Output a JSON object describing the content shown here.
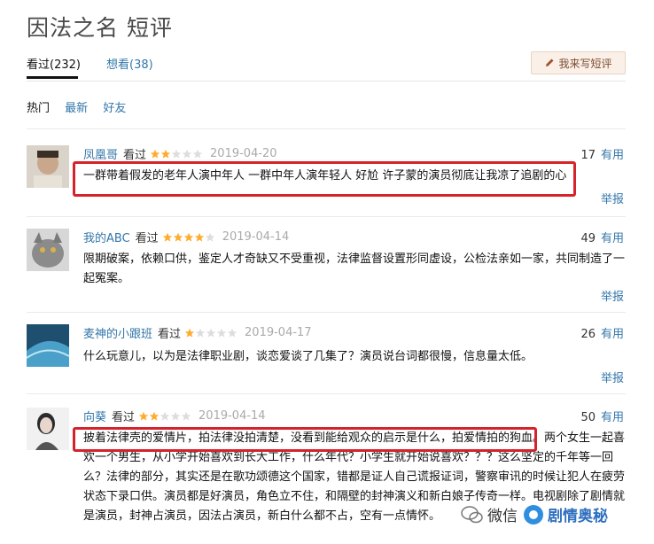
{
  "page": {
    "title": "因法之名 短评"
  },
  "tabs": [
    {
      "label": "看过(232)"
    },
    {
      "label": "想看(38)"
    }
  ],
  "write_button": {
    "label": "我来写短评"
  },
  "sort": [
    "热门",
    "最新",
    "好友"
  ],
  "watched_label": "看过",
  "useful_label": "有用",
  "report_label": "举报",
  "reviews": [
    {
      "user": "凤凰哥",
      "rating": 2,
      "date": "2019-04-20",
      "useful": "17",
      "text": "一群带着假发的老年人演中年人 一群中年人演年轻人 好尬 许子蒙的演员彻底让我凉了追剧的心",
      "avatar_color": "#c9a78c"
    },
    {
      "user": "我的ABC",
      "rating": 4,
      "date": "2019-04-14",
      "useful": "49",
      "text": "限期破案，依赖口供，鉴定人才奇缺又不受重视，法律监督设置形同虚设，公检法亲如一家，共同制造了一起冤案。",
      "avatar_color": "#8b8b8b"
    },
    {
      "user": "麦神的小跟班",
      "rating": 1,
      "date": "2019-04-17",
      "useful": "26",
      "text": "什么玩意儿，以为是法律职业剧，谈恋爱谈了几集了？演员说台词都很慢，信息量太低。",
      "avatar_color": "#4aa0c8"
    },
    {
      "user": "向葵",
      "rating": 2,
      "date": "2019-04-14",
      "useful": "50",
      "text": "披着法律壳的爱情片，拍法律没拍清楚，没看到能给观众的启示是什么，拍爱情拍的狗血。两个女生一起喜欢一个男生，从小学开始喜欢到长大工作，什么年代？小学生就开始说喜欢？？？这么坚定的千年等一回么？法律的部分，其实还是在歌功颂德这个国家，错都是证人自己谎报证词，警察审讯的时候让犯人在疲劳状态下录口供。演员都是好演员，角色立不住，和隔壁的封神演义和新白娘子传奇一样。电视剧除了剧情就是演员，封神占演员，因法占演员，新白什么都不占，空有一点情怀。",
      "avatar_color": "#999999"
    }
  ],
  "watermark": {
    "text": "微信",
    "brand": "剧情奥秘"
  },
  "colors": {
    "link": "#3377aa",
    "highlight": "#d6232b",
    "star": "#ffac2d"
  }
}
